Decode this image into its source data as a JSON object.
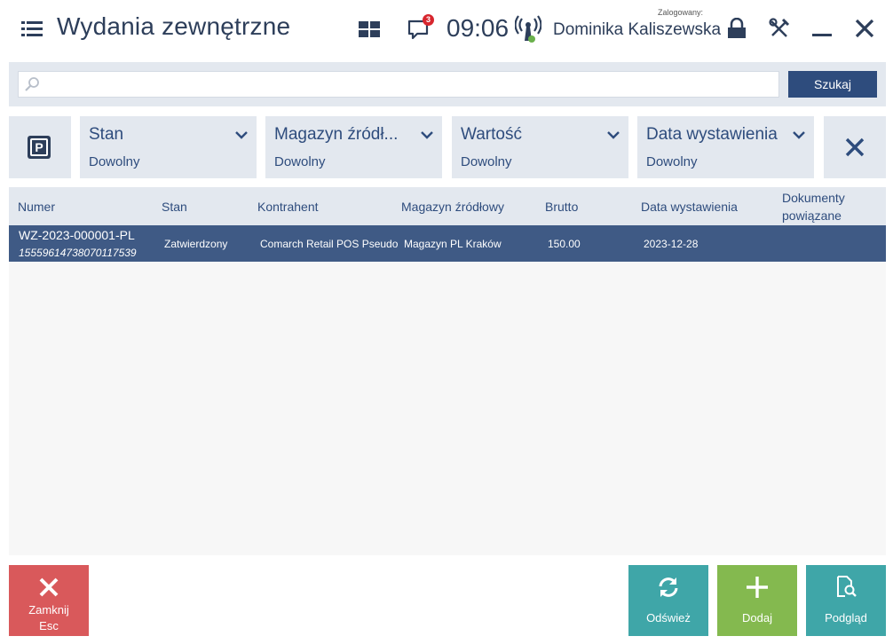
{
  "header": {
    "title": "Wydania zewnętrzne",
    "notification_count": "3",
    "clock": "09:06",
    "logged_label": "Zalogowany:",
    "user_name": "Dominika Kaliszewska"
  },
  "search": {
    "value": "",
    "placeholder": "",
    "button_label": "Szukaj"
  },
  "filters": [
    {
      "label": "Stan",
      "value": "Dowolny"
    },
    {
      "label": "Magazyn źródł...",
      "value": "Dowolny"
    },
    {
      "label": "Wartość",
      "value": "Dowolny"
    },
    {
      "label": "Data wystawienia",
      "value": "Dowolny"
    }
  ],
  "table": {
    "columns": [
      "Numer",
      "Stan",
      "Kontrahent",
      "Magazyn źródłowy",
      "Brutto",
      "Data wystawienia",
      "Dokumenty",
      "powiązane"
    ],
    "rows": [
      {
        "number": "WZ-2023-000001-PL",
        "code": "15559614738070117539",
        "state": "Zatwierdzony",
        "contractor": "Comarch Retail POS Pseudo",
        "warehouse": "Magazyn PL Kraków",
        "gross": "150.00",
        "date": "2023-12-28",
        "related": ""
      }
    ]
  },
  "buttons": {
    "close_label": "Zamknij",
    "close_shortcut": "Esc",
    "refresh_label": "Odśwież",
    "add_label": "Dodaj",
    "preview_label": "Podgląd"
  },
  "colors": {
    "primary": "#2e4c7d",
    "selected_row": "#3f5a85",
    "panel": "#e3e8ef",
    "close": "#d9595b",
    "teal": "#3fa6a8",
    "green": "#84b94f",
    "badge": "#d7262e"
  },
  "icons": [
    "hamburger-icon",
    "tiles-icon",
    "notification-icon",
    "signal-icon",
    "lock-icon",
    "tools-icon",
    "minimize-icon",
    "close-icon",
    "search-icon",
    "parking-icon",
    "chevron-down-icon",
    "clear-filters-icon",
    "refresh-icon",
    "plus-icon",
    "document-preview-icon"
  ]
}
